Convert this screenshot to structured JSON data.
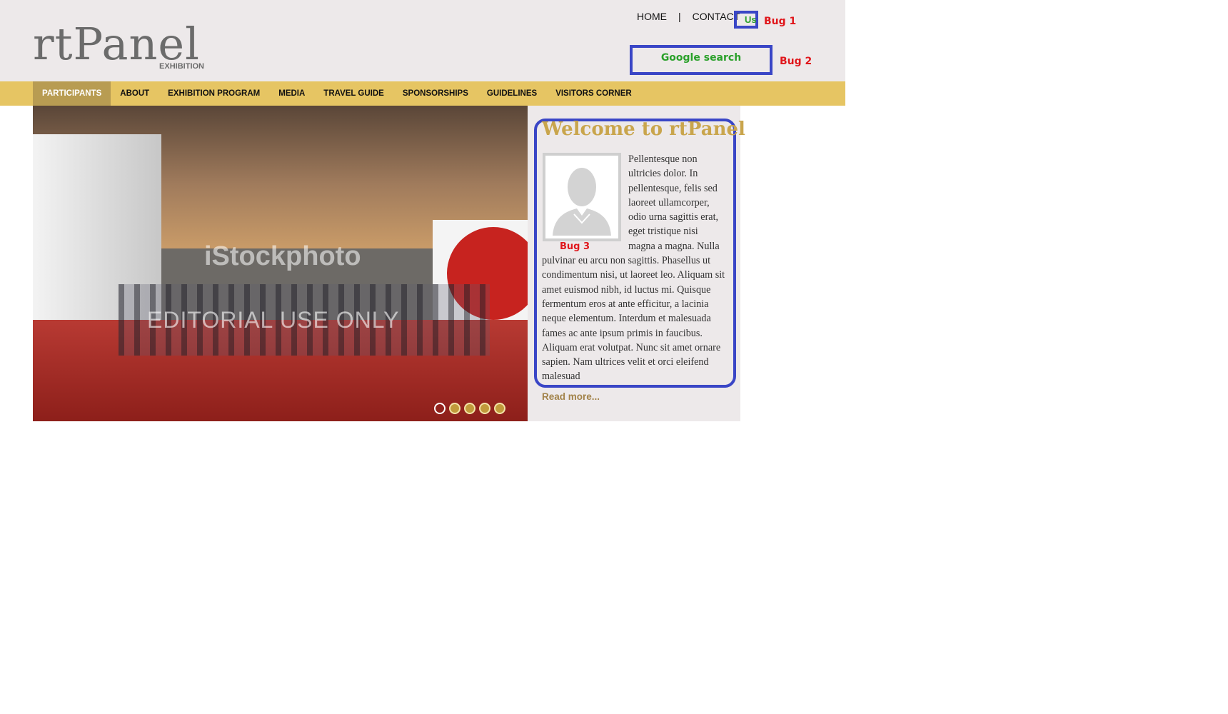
{
  "header": {
    "logo_text": "rtPanel",
    "logo_sub": "EXHIBITION",
    "topnav": {
      "home": "HOME",
      "separator": "|",
      "contact": "CONTACT",
      "us": "Us"
    },
    "search_label": "Google search",
    "bugs": {
      "bug1": "Bug 1",
      "bug2": "Bug 2",
      "bug3": "Bug 3"
    }
  },
  "mainnav": {
    "items": [
      {
        "label": "PARTICIPANTS"
      },
      {
        "label": "ABOUT"
      },
      {
        "label": "EXHIBITION PROGRAM"
      },
      {
        "label": "MEDIA"
      },
      {
        "label": "TRAVEL GUIDE"
      },
      {
        "label": "SPONSORSHIPS"
      },
      {
        "label": "GUIDELINES"
      },
      {
        "label": "VISITORS CORNER"
      }
    ],
    "active_index": 0
  },
  "slider": {
    "watermark_top": "iStockphoto",
    "watermark_bottom": "EDITORIAL USE ONLY",
    "dots_count": 5,
    "active_dot": 0
  },
  "welcome": {
    "title": "Welcome to rtPanel",
    "text": "Pellentesque non ultricies dolor. In pellentesque, felis sed laoreet ullamcorper, odio urna sagittis erat, eget tristique nisi magna a magna. Nulla pulvinar eu arcu non sagittis. Phasellus ut condimentum nisi, ut laoreet leo. Aliquam sit amet euismod nibh, id luctus mi. Quisque fermentum eros at ante efficitur, a lacinia neque elementum. Interdum et malesuada fames ac ante ipsum primis in faucibus. Aliquam erat volutpat. Nunc sit amet ornare sapien. Nam ultrices velit et orci eleifend malesuad",
    "read_more": "Read more..."
  },
  "colors": {
    "nav_bar": "#e6c563",
    "nav_active": "#b89c52",
    "header_bg": "#ede9ea",
    "title_gold": "#c9a54c",
    "bug_red": "#e0161b",
    "bug_outline_blue": "#3a46c6",
    "green_label": "#2aa02a"
  }
}
